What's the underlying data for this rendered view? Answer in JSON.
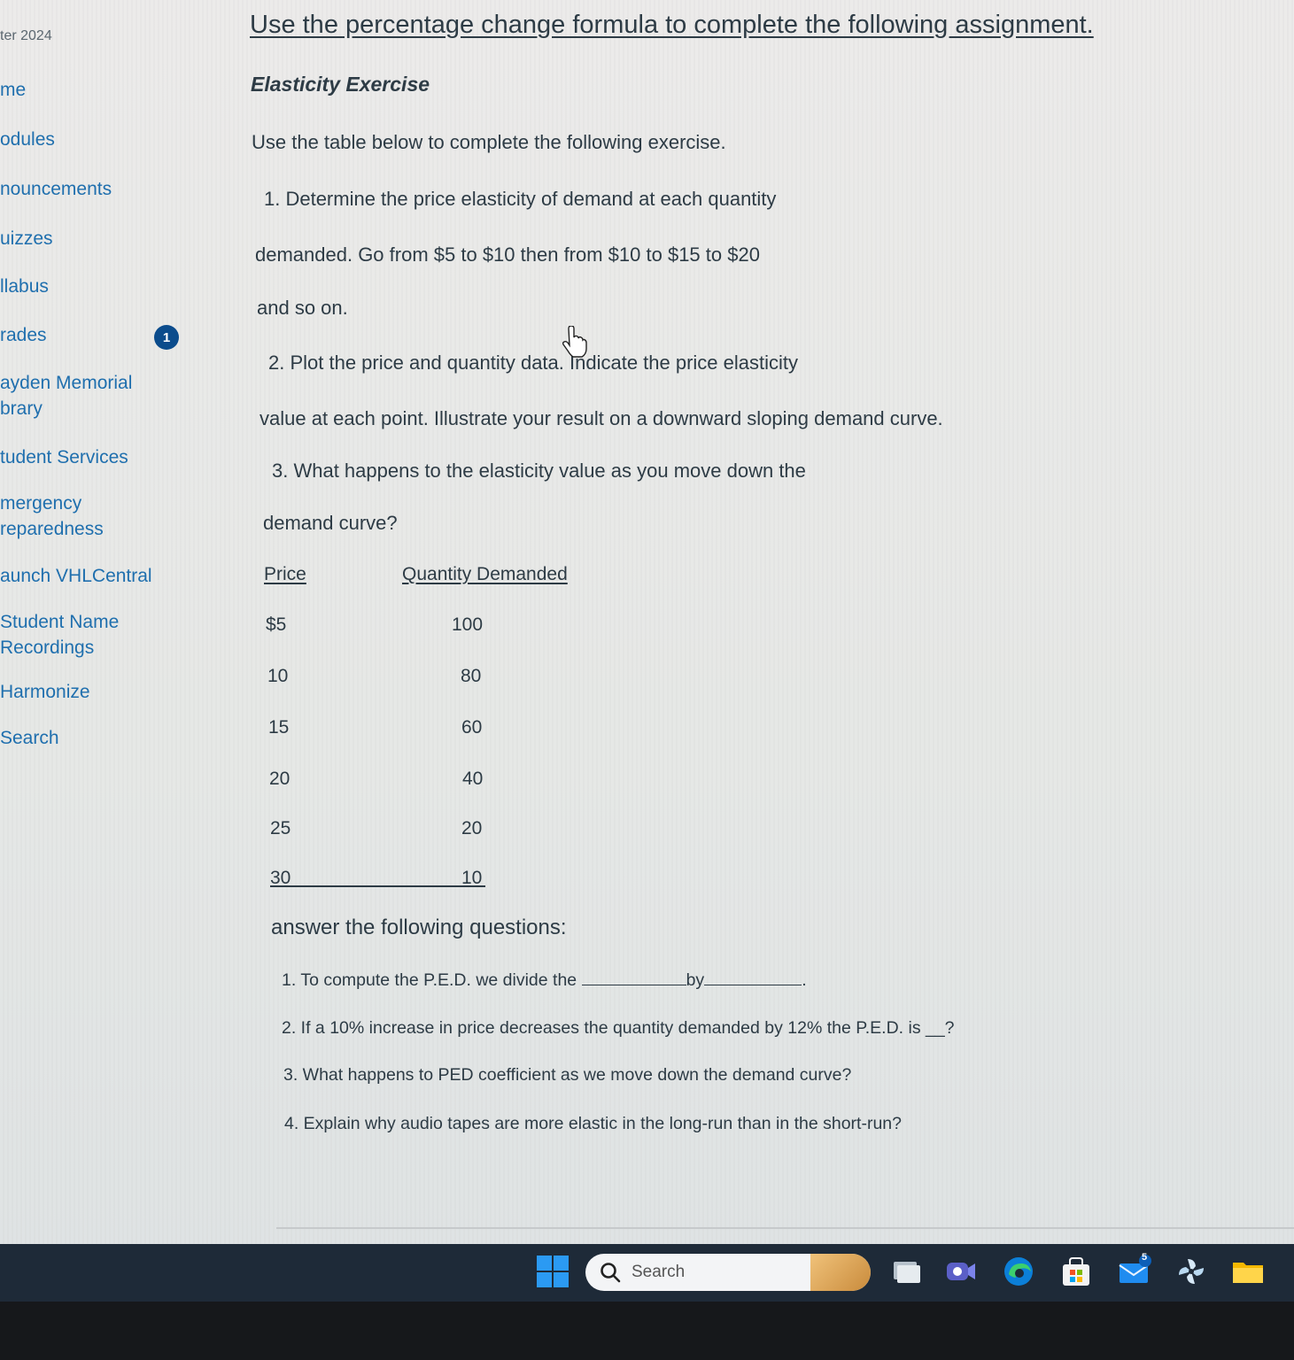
{
  "sidebar": {
    "term": "ter 2024",
    "items": [
      {
        "label": "me"
      },
      {
        "label": "odules"
      },
      {
        "label": "nouncements"
      },
      {
        "label": "uizzes"
      },
      {
        "label": "llabus"
      },
      {
        "label": "rades",
        "badge": "1"
      },
      {
        "label_line1": "ayden Memorial",
        "label_line2": "brary"
      },
      {
        "label": "tudent Services"
      },
      {
        "label_line1": "mergency",
        "label_line2": "reparedness"
      },
      {
        "label": "aunch VHLCentral"
      },
      {
        "label_line1": "Student Name",
        "label_line2": "Recordings"
      },
      {
        "label": "Harmonize"
      },
      {
        "label": "Search"
      }
    ]
  },
  "content": {
    "heading": "Use the percentage change formula to complete the following assignment.",
    "subheading": "Elasticity Exercise",
    "intro": "Use the table below to complete the following exercise.",
    "exercise": [
      {
        "line1": "1. Determine the price elasticity of demand at each quantity",
        "line2": "demanded. Go from $5 to $10 then from $10 to $15 to $20",
        "line3": "and so on."
      },
      {
        "line1": "2. Plot the price and quantity data. Indicate the price elasticity",
        "line2": "value at each point. Illustrate your result on a downward sloping demand curve."
      },
      {
        "line1": "3. What happens to the elasticity value as you move down the",
        "line2": "demand curve?"
      }
    ],
    "table": {
      "headers": [
        "Price",
        "Quantity Demanded"
      ],
      "rows": [
        [
          "$5",
          "100"
        ],
        [
          "10",
          "80"
        ],
        [
          "15",
          "60"
        ],
        [
          "20",
          "40"
        ],
        [
          "25",
          "20"
        ],
        [
          "30",
          "10"
        ]
      ]
    },
    "answer_intro": "answer the following questions:",
    "questions": {
      "q1_a": "1. To compute the P.E.D. we divide the",
      "q1_b": "by",
      "q1_end": ".",
      "q2": "2. If a 10% increase in price decreases the quantity demanded by 12% the P.E.D. is __?",
      "q3": "3. What happens to PED coefficient as we move down the demand curve?",
      "q4": "4. Explain why audio tapes are more elastic in the long-run than in the short-run?"
    }
  },
  "taskbar": {
    "search_placeholder": "Search",
    "mail_badge": "5",
    "icons": [
      "windows-start-icon",
      "search-icon",
      "task-view-icon",
      "meet-icon",
      "edge-browser-icon",
      "store-icon",
      "mail-icon",
      "pinwheel-app-icon",
      "file-explorer-icon"
    ],
    "colors": {
      "bar": "#1e2a38",
      "accent": "#0078d4"
    }
  },
  "colors": {
    "link": "#1f6fae",
    "text": "#2d3b45",
    "badge": "#0b4c8c"
  }
}
